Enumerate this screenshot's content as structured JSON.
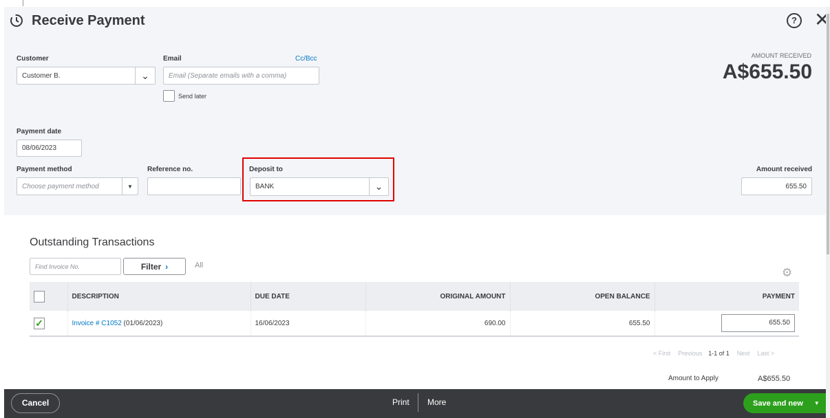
{
  "header": {
    "title": "Receive Payment",
    "help_icon": "question-circle-icon",
    "close_icon": "close-icon"
  },
  "form": {
    "customer_label": "Customer",
    "customer_value": "Customer B.",
    "email_label": "Email",
    "cc_bcc": "Cc/Bcc",
    "email_placeholder": "Email (Separate emails with a comma)",
    "send_later": "Send later",
    "amount_received_caption": "AMOUNT RECEIVED",
    "amount_received_big": "A$655.50",
    "payment_date_label": "Payment date",
    "payment_date": "08/06/2023",
    "payment_method_label": "Payment method",
    "payment_method_placeholder": "Choose payment method",
    "reference_label": "Reference no.",
    "reference_value": "",
    "deposit_label": "Deposit to",
    "deposit_value": "BANK",
    "amount_received_label": "Amount received",
    "amount_received_value": "655.50"
  },
  "transactions": {
    "title": "Outstanding Transactions",
    "find_placeholder": "Find Invoice No.",
    "filter": "Filter",
    "all": "All",
    "columns": [
      "DESCRIPTION",
      "DUE DATE",
      "ORIGINAL AMOUNT",
      "OPEN BALANCE",
      "PAYMENT"
    ],
    "rows": [
      {
        "link": "Invoice # C1052",
        "date_suffix": " (01/06/2023)",
        "due": "16/06/2023",
        "original": "690.00",
        "open": "655.50",
        "payment": "655.50",
        "checked": true
      }
    ],
    "pager": {
      "first": "< First",
      "previous": "Previous",
      "range": "1-1 of 1",
      "next": "Next",
      "last": "Last >"
    },
    "amount_to_apply_label": "Amount to Apply",
    "amount_to_apply": "A$655.50"
  },
  "footer": {
    "cancel": "Cancel",
    "print": "Print",
    "more": "More",
    "save": "Save and new"
  },
  "colors": {
    "accent": "#0077c5",
    "save": "#2ca01c",
    "highlight": "#e00000",
    "footer": "#393a3d"
  }
}
